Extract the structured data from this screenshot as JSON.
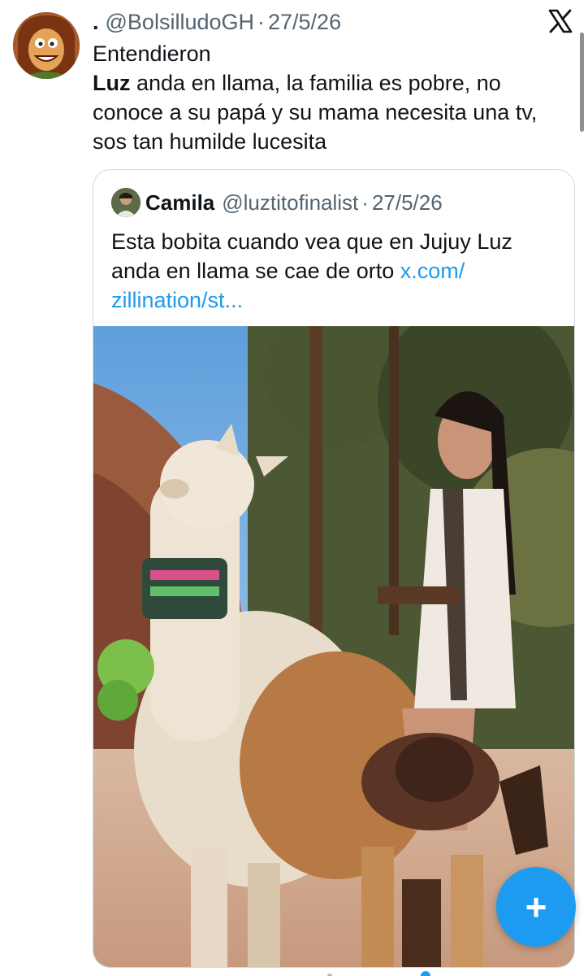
{
  "tweet": {
    "prefix": ".",
    "handle": "@BolsilludoGH",
    "separator": "·",
    "date": "27/5/26",
    "lines": {
      "l1": "Entendieron",
      "l2_bold": "Luz",
      "l2_rest": " anda en llama, la familia es pobre, no",
      "l3": "conoce a su papá y su mama necesita una tv,",
      "l4": "sos tan humilde lucesita"
    }
  },
  "quote": {
    "name": "Camila",
    "handle": "@luztitofinalist",
    "separator": "·",
    "date": "27/5/26",
    "line1": "Esta bobita cuando vea que en Jujuy Luz",
    "line2_text": "anda en llama se cae de orto ",
    "line2_link": "x.com/",
    "line3_link": "zillination/st..."
  },
  "fab": {
    "label": "+"
  },
  "icons": {
    "brand": "x-logo-icon",
    "compose": "plus-icon"
  },
  "colors": {
    "link": "#1d9bf0",
    "secondary_text": "#536471",
    "primary_text": "#0f1419",
    "border": "#cfd9de"
  }
}
